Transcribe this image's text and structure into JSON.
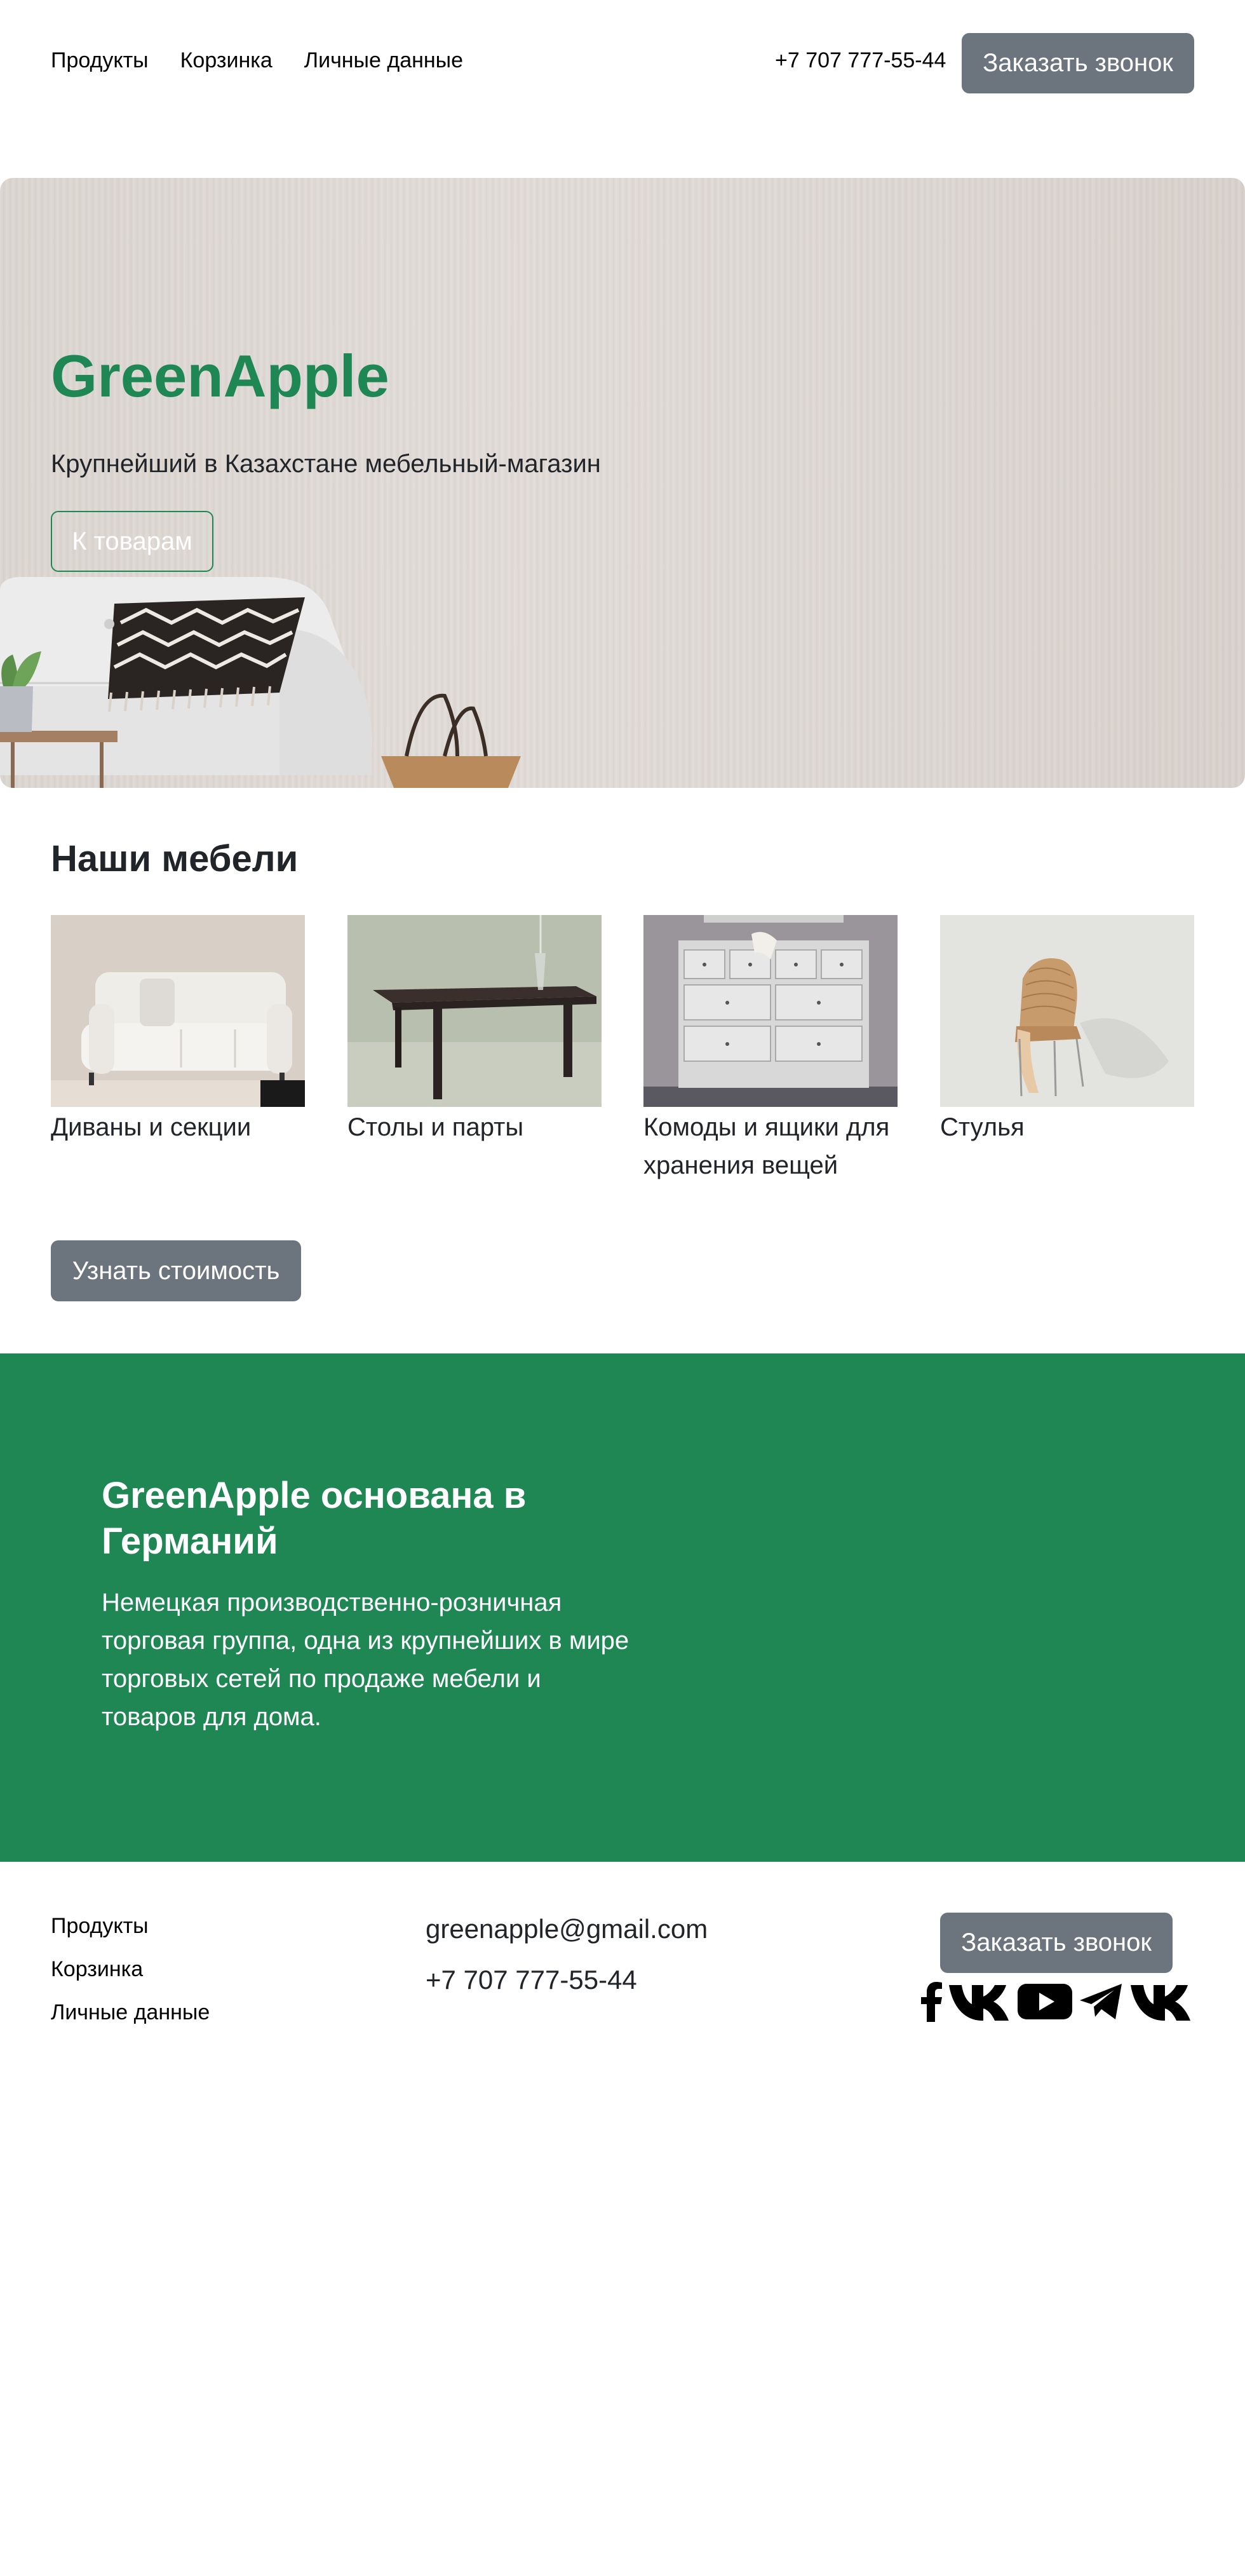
{
  "nav": {
    "links": [
      "Продукты",
      "Корзинка",
      "Личные данные"
    ],
    "phone": "+7 707 777-55-44",
    "call_button": "Заказать звонок"
  },
  "hero": {
    "title": "GreenApple",
    "subtitle": "Крупнейший в Казахстане мебельный-магазин",
    "button": "К товарам"
  },
  "furniture": {
    "title": "Наши мебели",
    "cards": [
      {
        "label": "Диваны и секции"
      },
      {
        "label": "Столы и парты"
      },
      {
        "label": "Комоды и ящики для хранения вещей"
      },
      {
        "label": "Стулья"
      }
    ],
    "price_button": "Узнать стоимость"
  },
  "about": {
    "title": "GreenApple основана в Германий",
    "text": "Немецкая производственно-розничная торговая группа, одна из крупнейших в мире торговых сетей по продаже мебели и товаров для дома."
  },
  "footer": {
    "links": [
      "Продукты",
      "Корзинка",
      "Личные данные"
    ],
    "email": "greenapple@gmail.com",
    "phone": "+7 707 777-55-44",
    "call_button": "Заказать звонок",
    "socials": [
      "facebook-icon",
      "vk-icon",
      "youtube-icon",
      "telegram-icon",
      "vk-icon"
    ]
  },
  "colors": {
    "brand_green": "#1e8754",
    "button_gray": "#6c757d",
    "text_dark": "#212529"
  }
}
